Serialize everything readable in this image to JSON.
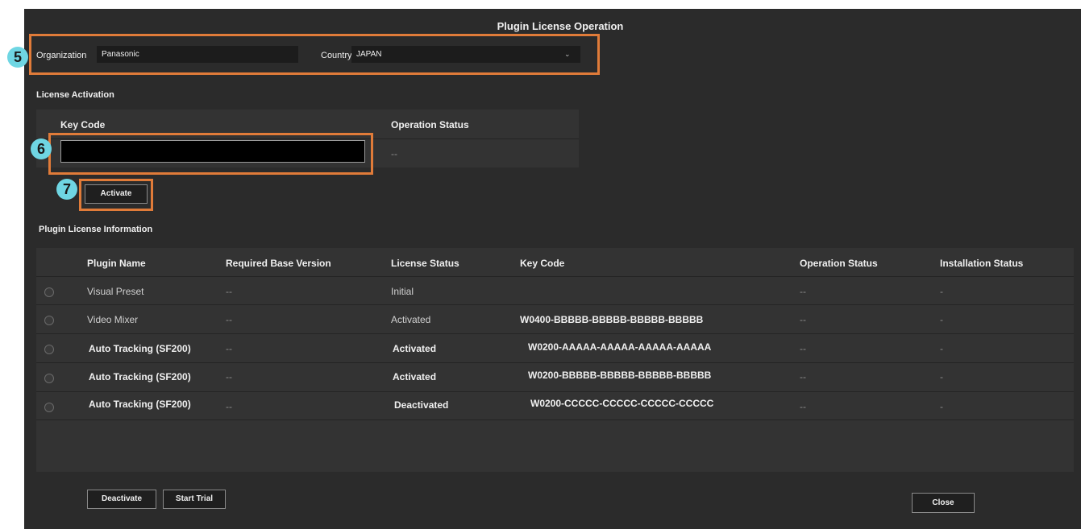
{
  "window": {
    "title": "Plugin License Operation"
  },
  "callouts": {
    "c5": "5",
    "c6": "6",
    "c7": "7"
  },
  "org": {
    "organization_label": "Organization",
    "organization_value": "Panasonic",
    "country_label": "Country",
    "country_value": "JAPAN"
  },
  "activation": {
    "section_title": "License Activation",
    "key_code_header": "Key Code",
    "operation_status_header": "Operation Status",
    "key_code_value": "",
    "operation_status_value": "--",
    "activate_label": "Activate"
  },
  "info": {
    "section_title": "Plugin License Information",
    "headers": {
      "plugin_name": "Plugin Name",
      "required_base_version": "Required Base Version",
      "license_status": "License Status",
      "key_code": "Key Code",
      "operation_status": "Operation Status",
      "installation_status": "Installation Status"
    },
    "rows": [
      {
        "plugin_name": "Visual Preset",
        "required_base_version": "--",
        "license_status": "Initial",
        "key_code": "",
        "operation_status": "--",
        "installation_status": "-"
      },
      {
        "plugin_name": "Video Mixer",
        "required_base_version": "--",
        "license_status": "Activated",
        "key_code": "W0400-BBBBB-BBBBB-BBBBB-BBBBB",
        "operation_status": "--",
        "installation_status": "-"
      },
      {
        "plugin_name": "Auto Tracking (SF200)",
        "required_base_version": "--",
        "license_status": "Activated",
        "key_code": "W0200-AAAAA-AAAAA-AAAAA-AAAAA",
        "operation_status": "--",
        "installation_status": "-"
      },
      {
        "plugin_name": "Auto Tracking (SF200)",
        "required_base_version": "--",
        "license_status": "Activated",
        "key_code": "W0200-BBBBB-BBBBB-BBBBB-BBBBB",
        "operation_status": "--",
        "installation_status": "-"
      },
      {
        "plugin_name": "Auto Tracking (SF200)",
        "required_base_version": "--",
        "license_status": "Deactivated",
        "key_code": "W0200-CCCCC-CCCCC-CCCCC-CCCCC",
        "operation_status": "--",
        "installation_status": "-"
      }
    ]
  },
  "footer": {
    "deactivate_label": "Deactivate",
    "start_trial_label": "Start Trial",
    "close_label": "Close"
  },
  "icons": {
    "dropdown": "chevron-down-icon",
    "radio": "radio-button-icon"
  },
  "colors": {
    "callout_box": "#e07b39",
    "callout_badge": "#6fd6e3",
    "window_bg": "#2b2b2b"
  }
}
